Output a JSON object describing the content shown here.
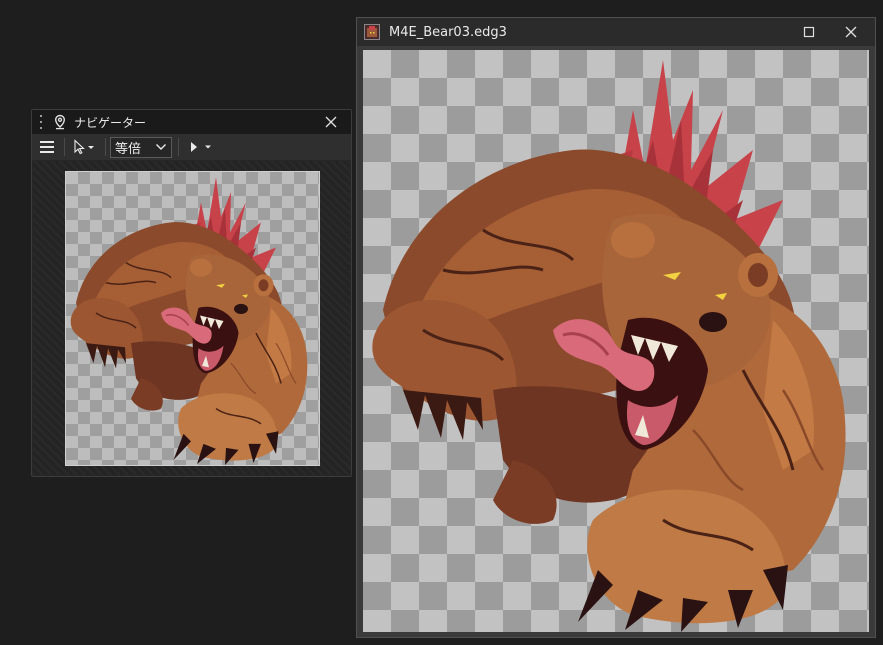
{
  "navigator": {
    "title": "ナビゲーター",
    "zoom_value": "等倍",
    "icons": [
      "grip-icon",
      "pin-icon",
      "close-icon",
      "hamburger-menu-icon",
      "pointer-icon",
      "chevron-down-icon",
      "play-icon"
    ]
  },
  "document": {
    "title": "M4E_Bear03.edg3",
    "icons": [
      "file-icon",
      "maximize-icon",
      "close-icon"
    ]
  },
  "artwork": {
    "subject": "bear-monster-illustration",
    "colors": {
      "fur_dark": "#5a2a1a",
      "fur_mid": "#8b4a2b",
      "fur_light": "#b8703e",
      "mane": "#c8424a",
      "tongue": "#d86a7a",
      "claw": "#2a1212"
    }
  }
}
